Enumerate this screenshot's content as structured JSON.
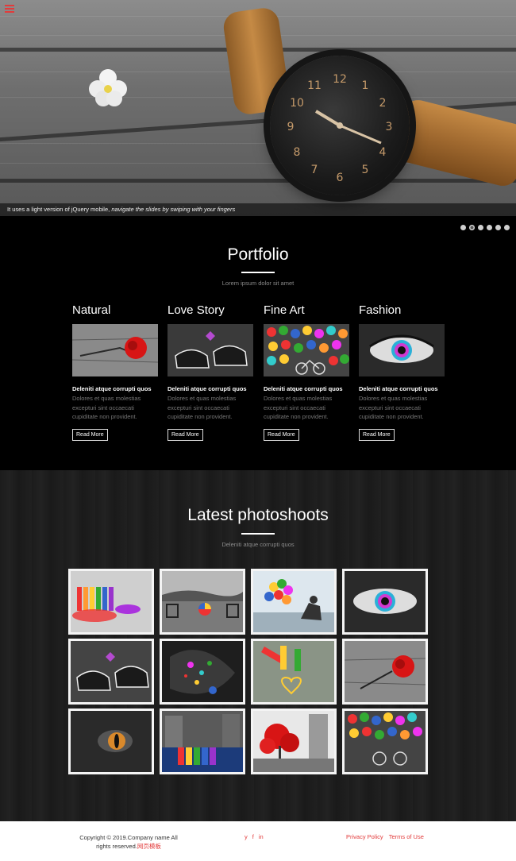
{
  "hero": {
    "caption_plain": "It uses a light version of jQuery mobile, ",
    "caption_italic": "navigate the slides by swiping with your fingers",
    "slide_count": 6,
    "active_slide": 2
  },
  "portfolio": {
    "title": "Portfolio",
    "subtitle": "Lorem ipsum dolor sit amet",
    "cards": [
      {
        "title": "Natural",
        "heading": "Deleniti atque corrupti quos",
        "body": "Dolores et quas molestias excepturi sint occaecati cupiditate non provident.",
        "button": "Read More"
      },
      {
        "title": "Love Story",
        "heading": "Deleniti atque corrupti quos",
        "body": "Dolores et quas molestias excepturi sint occaecati cupiditate non provident.",
        "button": "Read More"
      },
      {
        "title": "Fine Art",
        "heading": "Deleniti atque corrupti quos",
        "body": "Dolores et quas molestias excepturi sint occaecati cupiditate non provident.",
        "button": "Read More"
      },
      {
        "title": "Fashion",
        "heading": "Deleniti atque corrupti quos",
        "body": "Dolores et quas molestias excepturi sint occaecati cupiditate non provident.",
        "button": "Read More"
      }
    ]
  },
  "photoshoots": {
    "title": "Latest photoshoots",
    "subtitle": "Deleniti atque corrupti quos"
  },
  "footer": {
    "copyright_line1": "Copyright © 2019.Company name All",
    "copyright_line2": "rights reserved.",
    "copyright_link": "网页模板",
    "social": [
      "y",
      "f",
      "in"
    ],
    "links": [
      "Privacy Policy",
      "Terms of Use"
    ]
  },
  "colors": {
    "accent": "#e23b3b",
    "background": "#000000",
    "footer_bg": "#ffffff"
  }
}
